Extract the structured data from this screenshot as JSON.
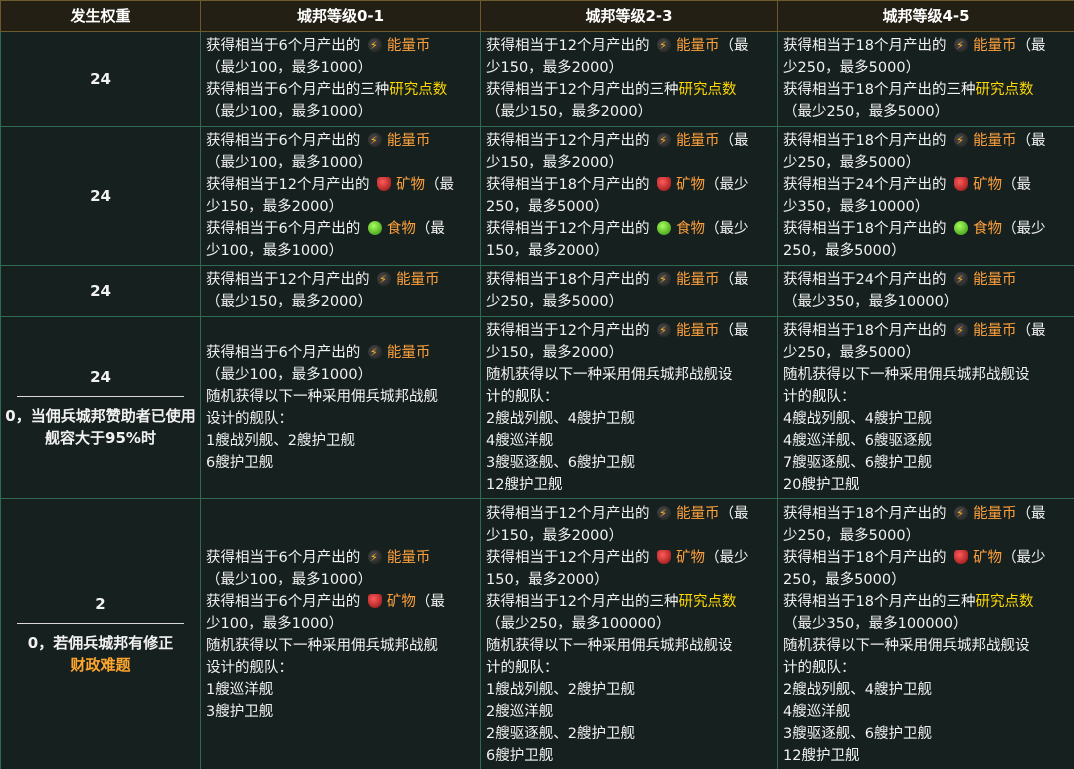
{
  "headers": [
    "发生权重",
    "城邦等级0-1",
    "城邦等级2-3",
    "城邦等级4-5"
  ],
  "icons": {
    "energy": "energy-credit-icon",
    "mineral": "mineral-gem-icon",
    "food": "food-apple-icon"
  },
  "colors": {
    "resource": "#ffa03c",
    "research": "#ffd800",
    "header_bg": "#241f14",
    "cell_bg": "#16211f",
    "border": "#2e6b52"
  },
  "rows": [
    {
      "weight": [
        "24"
      ],
      "cells": [
        [
          [
            {
              "t": "获得相当于6个月产出的 "
            },
            {
              "icon": "energy"
            },
            {
              "t": "能量币",
              "c": "energy"
            }
          ],
          [
            {
              "t": "（最少100，最多1000）"
            }
          ],
          [
            {
              "t": "获得相当于6个月产出的三种"
            },
            {
              "t": "研究点数",
              "c": "research"
            }
          ],
          [
            {
              "t": "（最少100，最多1000）"
            }
          ]
        ],
        [
          [
            {
              "t": "获得相当于12个月产出的 "
            },
            {
              "icon": "energy"
            },
            {
              "t": "能量币",
              "c": "energy"
            },
            {
              "t": "（最"
            }
          ],
          [
            {
              "t": "少150，最多2000）"
            }
          ],
          [
            {
              "t": "获得相当于12个月产出的三种"
            },
            {
              "t": "研究点数",
              "c": "research"
            }
          ],
          [
            {
              "t": "（最少150，最多2000）"
            }
          ]
        ],
        [
          [
            {
              "t": "获得相当于18个月产出的 "
            },
            {
              "icon": "energy"
            },
            {
              "t": "能量币",
              "c": "energy"
            },
            {
              "t": "（最"
            }
          ],
          [
            {
              "t": "少250，最多5000）"
            }
          ],
          [
            {
              "t": "获得相当于18个月产出的三种"
            },
            {
              "t": "研究点数",
              "c": "research"
            }
          ],
          [
            {
              "t": "（最少250，最多5000）"
            }
          ]
        ]
      ]
    },
    {
      "weight": [
        "24"
      ],
      "cells": [
        [
          [
            {
              "t": "获得相当于6个月产出的 "
            },
            {
              "icon": "energy"
            },
            {
              "t": "能量币",
              "c": "energy"
            }
          ],
          [
            {
              "t": "（最少100，最多1000）"
            }
          ],
          [
            {
              "t": "获得相当于12个月产出的 "
            },
            {
              "icon": "mineral"
            },
            {
              "t": "矿物",
              "c": "mineral"
            },
            {
              "t": "（最"
            }
          ],
          [
            {
              "t": "少150，最多2000）"
            }
          ],
          [
            {
              "t": "获得相当于6个月产出的 "
            },
            {
              "icon": "food"
            },
            {
              "t": "食物",
              "c": "food"
            },
            {
              "t": "（最"
            }
          ],
          [
            {
              "t": "少100，最多1000）"
            }
          ]
        ],
        [
          [
            {
              "t": "获得相当于12个月产出的 "
            },
            {
              "icon": "energy"
            },
            {
              "t": "能量币",
              "c": "energy"
            },
            {
              "t": "（最"
            }
          ],
          [
            {
              "t": "少150，最多2000）"
            }
          ],
          [
            {
              "t": "获得相当于18个月产出的 "
            },
            {
              "icon": "mineral"
            },
            {
              "t": "矿物",
              "c": "mineral"
            },
            {
              "t": "（最少"
            }
          ],
          [
            {
              "t": "250，最多5000）"
            }
          ],
          [
            {
              "t": "获得相当于12个月产出的 "
            },
            {
              "icon": "food"
            },
            {
              "t": "食物",
              "c": "food"
            },
            {
              "t": "（最少"
            }
          ],
          [
            {
              "t": "150，最多2000）"
            }
          ]
        ],
        [
          [
            {
              "t": "获得相当于18个月产出的 "
            },
            {
              "icon": "energy"
            },
            {
              "t": "能量币",
              "c": "energy"
            },
            {
              "t": "（最"
            }
          ],
          [
            {
              "t": "少250，最多5000）"
            }
          ],
          [
            {
              "t": "获得相当于24个月产出的 "
            },
            {
              "icon": "mineral"
            },
            {
              "t": "矿物",
              "c": "mineral"
            },
            {
              "t": "（最"
            }
          ],
          [
            {
              "t": "少350，最多10000）"
            }
          ],
          [
            {
              "t": "获得相当于18个月产出的 "
            },
            {
              "icon": "food"
            },
            {
              "t": "食物",
              "c": "food"
            },
            {
              "t": "（最少"
            }
          ],
          [
            {
              "t": "250，最多5000）"
            }
          ]
        ]
      ]
    },
    {
      "weight": [
        "24"
      ],
      "cells": [
        [
          [
            {
              "t": "获得相当于12个月产出的 "
            },
            {
              "icon": "energy"
            },
            {
              "t": "能量币",
              "c": "energy"
            }
          ],
          [
            {
              "t": "（最少150，最多2000）"
            }
          ]
        ],
        [
          [
            {
              "t": "获得相当于18个月产出的 "
            },
            {
              "icon": "energy"
            },
            {
              "t": "能量币",
              "c": "energy"
            },
            {
              "t": "（最"
            }
          ],
          [
            {
              "t": "少250，最多5000）"
            }
          ]
        ],
        [
          [
            {
              "t": "获得相当于24个月产出的 "
            },
            {
              "icon": "energy"
            },
            {
              "t": "能量币",
              "c": "energy"
            }
          ],
          [
            {
              "t": "（最少350，最多10000）"
            }
          ]
        ]
      ]
    },
    {
      "weight": [
        "24",
        "0，当佣兵城邦赞助者已使用舰容大于95%时"
      ],
      "cells": [
        [
          [
            {
              "t": "获得相当于6个月产出的 "
            },
            {
              "icon": "energy"
            },
            {
              "t": "能量币",
              "c": "energy"
            }
          ],
          [
            {
              "t": "（最少100，最多1000）"
            }
          ],
          [
            {
              "t": "随机获得以下一种采用佣兵城邦战舰"
            }
          ],
          [
            {
              "t": "设计的舰队："
            }
          ],
          [
            {
              "t": "1艘战列舰、2艘护卫舰"
            }
          ],
          [
            {
              "t": "6艘护卫舰"
            }
          ]
        ],
        [
          [
            {
              "t": "获得相当于12个月产出的 "
            },
            {
              "icon": "energy"
            },
            {
              "t": "能量币",
              "c": "energy"
            },
            {
              "t": "（最"
            }
          ],
          [
            {
              "t": "少150，最多2000）"
            }
          ],
          [
            {
              "t": "随机获得以下一种采用佣兵城邦战舰设"
            }
          ],
          [
            {
              "t": "计的舰队："
            }
          ],
          [
            {
              "t": "2艘战列舰、4艘护卫舰"
            }
          ],
          [
            {
              "t": "4艘巡洋舰"
            }
          ],
          [
            {
              "t": "3艘驱逐舰、6艘护卫舰"
            }
          ],
          [
            {
              "t": "12艘护卫舰"
            }
          ]
        ],
        [
          [
            {
              "t": "获得相当于18个月产出的 "
            },
            {
              "icon": "energy"
            },
            {
              "t": "能量币",
              "c": "energy"
            },
            {
              "t": "（最"
            }
          ],
          [
            {
              "t": "少250，最多5000）"
            }
          ],
          [
            {
              "t": "随机获得以下一种采用佣兵城邦战舰设"
            }
          ],
          [
            {
              "t": "计的舰队："
            }
          ],
          [
            {
              "t": "4艘战列舰、4艘护卫舰"
            }
          ],
          [
            {
              "t": "4艘巡洋舰、6艘驱逐舰"
            }
          ],
          [
            {
              "t": "7艘驱逐舰、6艘护卫舰"
            }
          ],
          [
            {
              "t": "20艘护卫舰"
            }
          ]
        ]
      ]
    },
    {
      "weight": [
        "2",
        "0，若佣兵城邦有修正"
      ],
      "weight_extra": "财政难题",
      "cells": [
        [
          [
            {
              "t": "获得相当于6个月产出的 "
            },
            {
              "icon": "energy"
            },
            {
              "t": "能量币",
              "c": "energy"
            }
          ],
          [
            {
              "t": "（最少100，最多1000）"
            }
          ],
          [
            {
              "t": "获得相当于6个月产出的 "
            },
            {
              "icon": "mineral"
            },
            {
              "t": "矿物",
              "c": "mineral"
            },
            {
              "t": "（最"
            }
          ],
          [
            {
              "t": "少100，最多1000）"
            }
          ],
          [
            {
              "t": "随机获得以下一种采用佣兵城邦战舰"
            }
          ],
          [
            {
              "t": "设计的舰队："
            }
          ],
          [
            {
              "t": "1艘巡洋舰"
            }
          ],
          [
            {
              "t": "3艘护卫舰"
            }
          ]
        ],
        [
          [
            {
              "t": "获得相当于12个月产出的 "
            },
            {
              "icon": "energy"
            },
            {
              "t": "能量币",
              "c": "energy"
            },
            {
              "t": "（最"
            }
          ],
          [
            {
              "t": "少150，最多2000）"
            }
          ],
          [
            {
              "t": "获得相当于12个月产出的 "
            },
            {
              "icon": "mineral"
            },
            {
              "t": "矿物",
              "c": "mineral"
            },
            {
              "t": "（最少"
            }
          ],
          [
            {
              "t": "150，最多2000）"
            }
          ],
          [
            {
              "t": "获得相当于12个月产出的三种"
            },
            {
              "t": "研究点数",
              "c": "research"
            }
          ],
          [
            {
              "t": "（最少250，最多100000）"
            }
          ],
          [
            {
              "t": "随机获得以下一种采用佣兵城邦战舰设"
            }
          ],
          [
            {
              "t": "计的舰队："
            }
          ],
          [
            {
              "t": "1艘战列舰、2艘护卫舰"
            }
          ],
          [
            {
              "t": "2艘巡洋舰"
            }
          ],
          [
            {
              "t": "2艘驱逐舰、2艘护卫舰"
            }
          ],
          [
            {
              "t": "6艘护卫舰"
            }
          ]
        ],
        [
          [
            {
              "t": "获得相当于18个月产出的 "
            },
            {
              "icon": "energy"
            },
            {
              "t": "能量币",
              "c": "energy"
            },
            {
              "t": "（最"
            }
          ],
          [
            {
              "t": "少250，最多5000）"
            }
          ],
          [
            {
              "t": "获得相当于18个月产出的 "
            },
            {
              "icon": "mineral"
            },
            {
              "t": "矿物",
              "c": "mineral"
            },
            {
              "t": "（最少"
            }
          ],
          [
            {
              "t": "250，最多5000）"
            }
          ],
          [
            {
              "t": "获得相当于18个月产出的三种"
            },
            {
              "t": "研究点数",
              "c": "research"
            }
          ],
          [
            {
              "t": "（最少350，最多100000）"
            }
          ],
          [
            {
              "t": "随机获得以下一种采用佣兵城邦战舰设"
            }
          ],
          [
            {
              "t": "计的舰队："
            }
          ],
          [
            {
              "t": "2艘战列舰、4艘护卫舰"
            }
          ],
          [
            {
              "t": "4艘巡洋舰"
            }
          ],
          [
            {
              "t": "3艘驱逐舰、6艘护卫舰"
            }
          ],
          [
            {
              "t": "12艘护卫舰"
            }
          ]
        ]
      ]
    }
  ]
}
